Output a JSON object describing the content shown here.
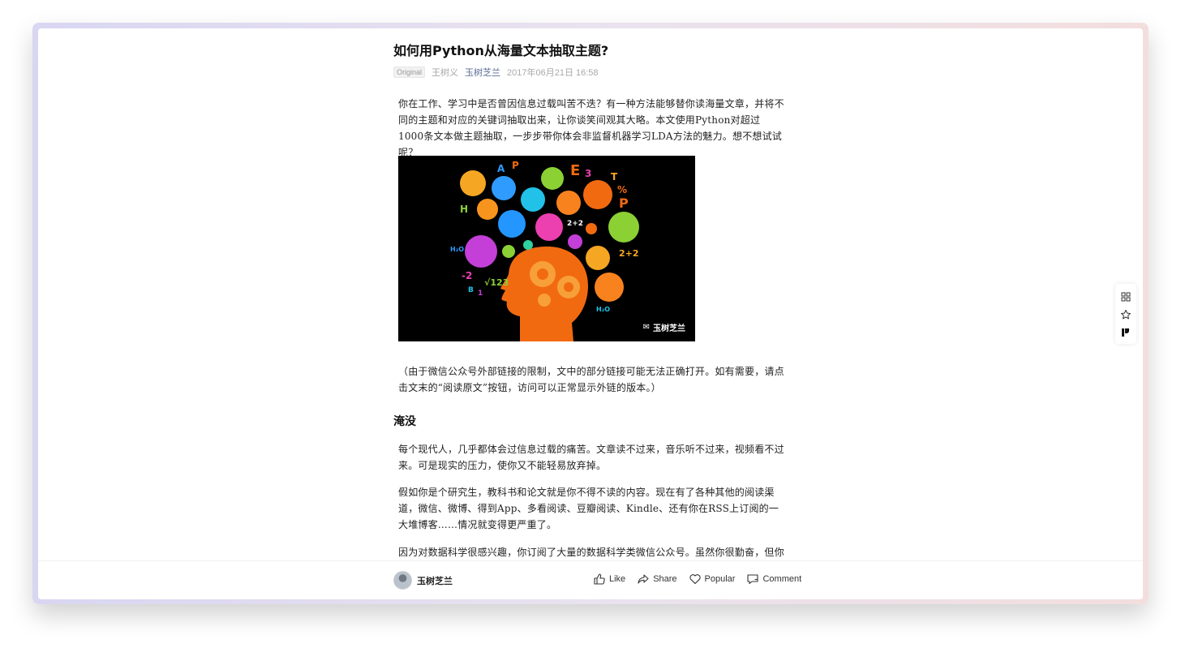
{
  "article": {
    "title": "如何用Python从海量文本抽取主题?",
    "meta": {
      "tag": "Original",
      "author": "王树义",
      "account": "玉树芝兰",
      "datetime": "2017年06月21日 16:58"
    },
    "paragraph1": "你在工作、学习中是否曾因信息过载叫苦不迭？有一种方法能够替你读海量文章，并将不同的主题和对应的关键词抽取出来，让你谈笑间观其大略。本文使用Python对超过1000条文本做主题抽取，一步步带你体会非监督机器学习LDA方法的魅力。想不想试试呢？",
    "image": {
      "watermark": "玉树芝兰",
      "glyphs": [
        "A",
        "P",
        "E",
        "3",
        "T",
        "%",
        "H",
        "P",
        "2+2",
        "2+2",
        "-2",
        "√123",
        "B",
        "1",
        "H₂O",
        "H₂O"
      ]
    },
    "paragraph2": "（由于微信公众号外部链接的限制，文中的部分链接可能无法正确打开。如有需要，请点击文末的“阅读原文”按钮，访问可以正常显示外链的版本。）",
    "section_heading": "淹没",
    "paragraph3": "每个现代人，几乎都体会过信息过载的痛苦。文章读不过来，音乐听不过来，视频看不过来。可是现实的压力，使你又不能轻易放弃掉。",
    "paragraph4": "假如你是个研究生，教科书和论文就是你不得不读的内容。现在有了各种其他的阅读渠道，微信、微博、得到App、多看阅读、豆瓣阅读、Kindle、还有你在RSS上订阅的一大堆博客……情况就变得更严重了。",
    "paragraph5": "因为对数据科学很感兴趣，你订阅了大量的数据科学类微信公众号。虽然你很勤奋，但你"
  },
  "bottom_bar": {
    "author_name": "玉树芝兰",
    "like_label": "Like",
    "share_label": "Share",
    "popular_label": "Popular",
    "comment_label": "Comment"
  },
  "side_tools": {
    "icons": [
      "grid-icon",
      "star-icon",
      "brand-logo-icon"
    ]
  },
  "colors": {
    "account_link": "#576b95",
    "image_background": "#000000",
    "head_orange": "#f26a10"
  }
}
